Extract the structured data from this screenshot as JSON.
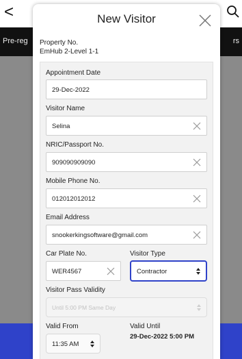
{
  "background": {
    "back_glyph": "<",
    "tab_left": "Pre-reg",
    "tab_right": "rs"
  },
  "modal": {
    "title": "New Visitor",
    "property_label": "Property No.",
    "property_value": "EmHub 2-Level 1-1"
  },
  "form": {
    "appointment_date": {
      "label": "Appointment Date",
      "value": "29-Dec-2022"
    },
    "visitor_name": {
      "label": "Visitor Name",
      "value": "Selina"
    },
    "nric": {
      "label": "NRIC/Passport No.",
      "value": "909090909090"
    },
    "mobile": {
      "label": "Mobile Phone No.",
      "value": "012012012012"
    },
    "email": {
      "label": "Email Address",
      "value": "snookerkingsoftware@gmail.com"
    },
    "car_plate": {
      "label": "Car Plate No.",
      "value": "WER4567"
    },
    "visitor_type": {
      "label": "Visitor Type",
      "value": "Contractor"
    },
    "pass_validity": {
      "label": "Visitor Pass Validity",
      "value": "Until 5:00 PM Same Day"
    },
    "valid_from": {
      "label": "Valid From",
      "value": "11:35 AM"
    },
    "valid_until": {
      "label": "Valid Until",
      "value": "29-Dec-2022 5:00 PM"
    }
  },
  "icons": {
    "close": "close-icon",
    "clear": "clear-icon",
    "select_arrows": "select-arrows-icon",
    "search": "search-icon",
    "back": "back-chevron-icon"
  },
  "colors": {
    "accent": "#2f42c9",
    "overlay": "#8a8a8a",
    "tabbar": "#111111"
  }
}
